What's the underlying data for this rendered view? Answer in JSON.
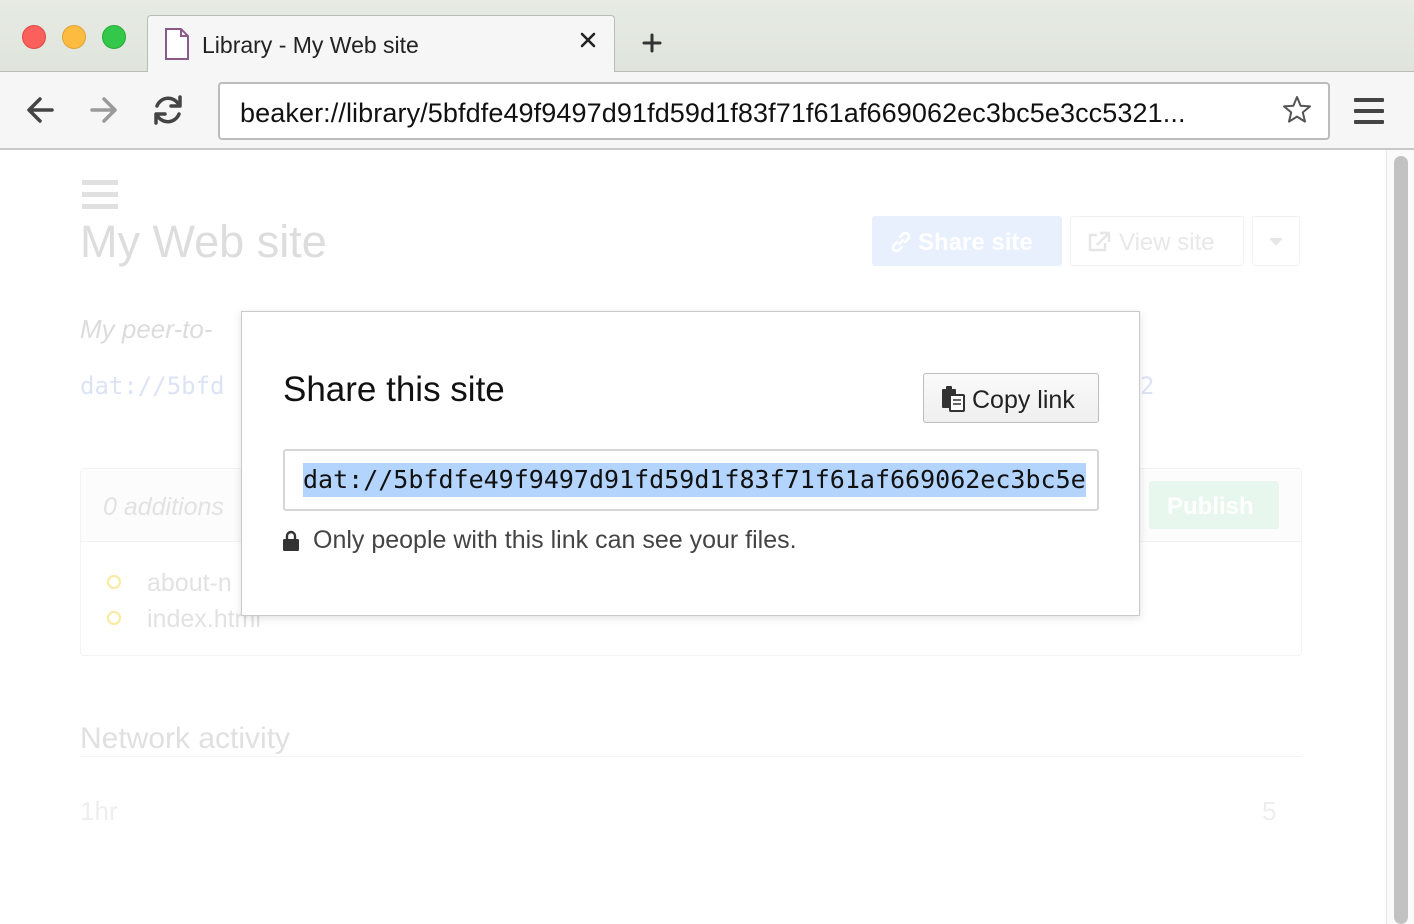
{
  "browser": {
    "tab": {
      "title": "Library - My Web site"
    },
    "address_bar": {
      "url": "beaker://library/5bfdfe49f9497d91fd59d1f83f71f61af669062ec3bc5e3cc5321..."
    }
  },
  "page": {
    "title": "My Web site",
    "share_site_label": "Share site",
    "view_site_label": "View site",
    "description": "My peer-to-",
    "dat_url_fragment": "dat://5bfd",
    "dat_url_tail_fragment": "2",
    "changes": {
      "summary": "0 additions",
      "publish_label": "Publish",
      "files": [
        "about-n",
        "index.html"
      ]
    },
    "network": {
      "heading": "Network activity",
      "period": "1hr",
      "count": "5"
    }
  },
  "modal": {
    "title": "Share this site",
    "copy_link_label": "Copy link",
    "share_url": "dat://5bfdfe49f9497d91fd59d1f83f71f61af669062ec3bc5e",
    "privacy_note": "Only people with this link can see your files."
  },
  "colors": {
    "traffic_close": "#fc605c",
    "traffic_minimize": "#fdbc40",
    "traffic_maximize": "#34c84a",
    "selection_highlight": "#b3d4fc"
  },
  "icons": [
    "document-icon",
    "close-icon",
    "plus-icon",
    "back-arrow-icon",
    "forward-arrow-icon",
    "reload-icon",
    "star-icon",
    "hamburger-menu-icon",
    "link-icon",
    "external-link-icon",
    "caret-down-icon",
    "clipboard-icon",
    "lock-icon"
  ]
}
